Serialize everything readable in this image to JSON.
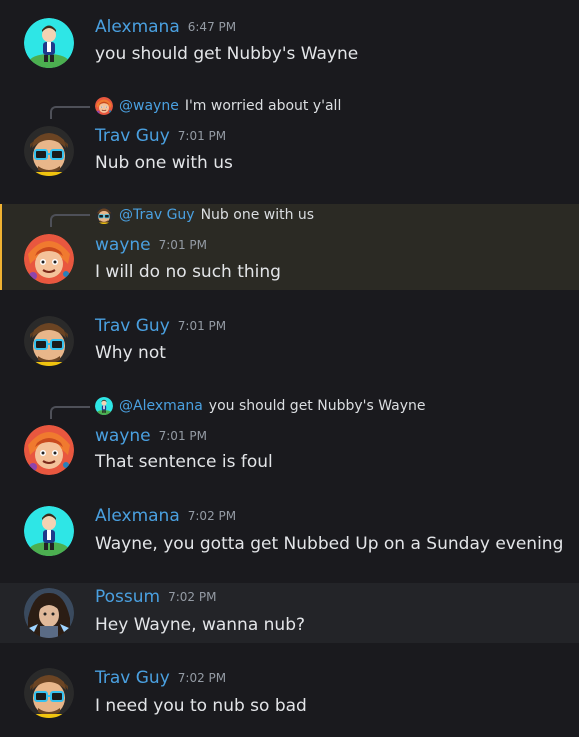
{
  "messages": [
    {
      "author": "Alexmana",
      "time": "6:47 PM",
      "text": "you should get Nubby's Wayne"
    },
    {
      "author": "Trav Guy",
      "time": "7:01 PM",
      "text": "Nub one with us",
      "reply": {
        "author": "@wayne",
        "text": "I'm worried about y'all"
      }
    },
    {
      "author": "wayne",
      "time": "7:01 PM",
      "text": "I will do no such thing",
      "reply": {
        "author": "@Trav Guy",
        "text": "Nub one with us"
      }
    },
    {
      "author": "Trav Guy",
      "time": "7:01 PM",
      "text": "Why not"
    },
    {
      "author": "wayne",
      "time": "7:01 PM",
      "text": "That sentence is foul",
      "reply": {
        "author": "@Alexmana",
        "text": "you should get Nubby's Wayne"
      }
    },
    {
      "author": "Alexmana",
      "time": "7:02 PM",
      "text": "Wayne, you gotta get Nubbed Up on a Sunday evening"
    },
    {
      "author": "Possum",
      "time": "7:02 PM",
      "text": "Hey Wayne, wanna nub?"
    },
    {
      "author": "Trav Guy",
      "time": "7:02 PM",
      "text": "I need you to nub so bad"
    }
  ],
  "colors": {
    "background": "#1a1a1e",
    "username": "#4aa0e0",
    "mention_highlight": "#2b2a24",
    "mention_bar": "#f0b232",
    "hover_row": "#232428"
  }
}
